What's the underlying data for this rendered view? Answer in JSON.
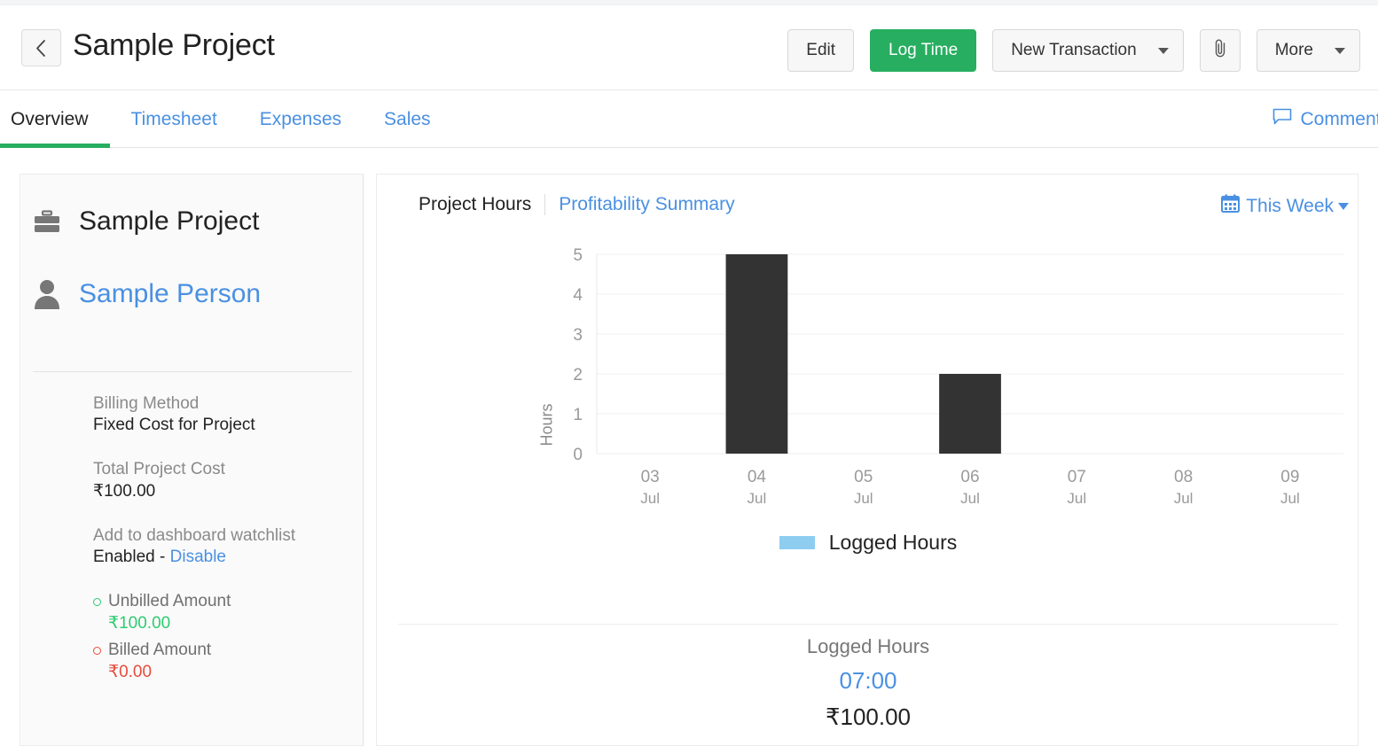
{
  "header": {
    "back_icon": "chevron-left-icon",
    "title": "Sample Project",
    "buttons": {
      "edit": "Edit",
      "log_time": "Log Time",
      "new_transaction": "New Transaction",
      "attach_icon": "paperclip-icon",
      "more": "More"
    },
    "primary_color": "#27ae60"
  },
  "tabs": {
    "items": [
      {
        "label": "Overview",
        "active": true
      },
      {
        "label": "Timesheet",
        "active": false
      },
      {
        "label": "Expenses",
        "active": false
      },
      {
        "label": "Sales",
        "active": false
      }
    ],
    "comments": {
      "label": "Comments",
      "icon": "comment-icon"
    },
    "active_underline_color": "#27ae60",
    "link_color": "#4a90e2"
  },
  "sidebar": {
    "project_icon": "briefcase-icon",
    "project_name": "Sample Project",
    "person_icon": "user-icon",
    "person_name": "Sample Person",
    "fields": [
      {
        "label": "Billing Method",
        "value": "Fixed Cost for Project"
      },
      {
        "label": "Total Project Cost",
        "value": "₹100.00"
      }
    ],
    "watchlist": {
      "label": "Add to dashboard watchlist",
      "state": "Enabled - ",
      "action": "Disable"
    },
    "amounts": [
      {
        "label": "Unbilled Amount",
        "value": "₹100.00",
        "color": "#2ecc71"
      },
      {
        "label": "Billed Amount",
        "value": "₹0.00",
        "color": "#e74c3c"
      }
    ]
  },
  "chart_panel": {
    "tab_active": "Project Hours",
    "tab_link": "Profitability Summary",
    "period": {
      "icon": "calendar-icon",
      "label": "This Week"
    },
    "legend": {
      "label": "Logged Hours",
      "color": "#8ecdf0"
    },
    "summary": {
      "title": "Logged Hours",
      "hours": "07:00",
      "amount": "₹100.00"
    }
  },
  "chart_data": {
    "type": "bar",
    "title": "Project Hours",
    "xlabel": "",
    "ylabel": "Hours",
    "categories": [
      "03\nJul",
      "04\nJul",
      "05\nJul",
      "06\nJul",
      "07\nJul",
      "08\nJul",
      "09\nJul"
    ],
    "tick_days": [
      "03",
      "04",
      "05",
      "06",
      "07",
      "08",
      "09"
    ],
    "tick_months": [
      "Jul",
      "Jul",
      "Jul",
      "Jul",
      "Jul",
      "Jul",
      "Jul"
    ],
    "values": [
      0,
      5,
      0,
      2,
      0,
      0,
      0
    ],
    "series": [
      {
        "name": "Logged Hours",
        "values": [
          0,
          5,
          0,
          2,
          0,
          0,
          0
        ],
        "color": "#333333"
      }
    ],
    "ylim": [
      0,
      5
    ],
    "yticks": [
      0,
      1,
      2,
      3,
      4,
      5
    ],
    "grid": true,
    "legend_position": "bottom",
    "bar_color": "#333333",
    "legend_color": "#8ecdf0"
  }
}
